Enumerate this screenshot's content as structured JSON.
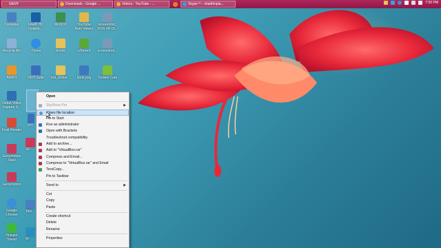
{
  "taskbar": {
    "tabs": [
      {
        "label": "GENY",
        "icon": "genymotion-icon",
        "color": "#c94747"
      },
      {
        "label": "Downloads - Google ...",
        "icon": "chrome-icon",
        "color": "#e8b23a"
      },
      {
        "label": "Videos - YouTube - ...",
        "icon": "chrome-icon",
        "color": "#e8b23a"
      },
      {
        "label": "Skype™ - shadhinpla...",
        "icon": "skype-icon",
        "color": "#29a8e0"
      }
    ],
    "time": "7:50 PM"
  },
  "desktop_icons": [
    {
      "label": "Computer",
      "color": "#4a7fc1"
    },
    {
      "label": "Intel® HD Graphic...",
      "color": "#1a5fa8"
    },
    {
      "label": "WinSCP",
      "color": "#3b8f4f"
    },
    {
      "label": "YouTube Auto Viewer",
      "color": "#e0b84a"
    },
    {
      "label": "screenshot_ 2016-08-15...",
      "color": "#7a9ab8"
    },
    {
      "label": "Recycle Bin",
      "color": "#8fb2d4"
    },
    {
      "label": "iTunes",
      "color": "#2f8fe3"
    },
    {
      "label": "books",
      "color": "#e6c25a"
    },
    {
      "label": "uTorrent",
      "color": "#5aa83a"
    },
    {
      "label": "screenshot...",
      "color": "#7a9ab8"
    },
    {
      "label": "AIMP3",
      "color": "#e8952a"
    },
    {
      "label": "NCH Suite",
      "color": "#3a6fbf"
    },
    {
      "label": "bot_clicker...",
      "color": "#e6c25a"
    },
    {
      "label": "book.png",
      "color": "#3c7abf"
    },
    {
      "label": "Toolwiz Care",
      "color": "#7dbf3a"
    },
    {
      "label": "Debut Video Capture S...",
      "color": "#2f6fb3"
    },
    {
      "label": "Foxit Reader",
      "color": "#d84a3a"
    },
    {
      "label": "Genymotion Shell",
      "color": "#c93a5a"
    },
    {
      "label": "Genymotion",
      "color": "#c93a5a"
    },
    {
      "label": "Google Chrome",
      "color": "#3a8fd8"
    },
    {
      "label": "Hotspot Shield",
      "color": "#3fb83f"
    }
  ],
  "partial_labels": {
    "behind1": "Sk",
    "behind2": "SH",
    "behind3": "SP",
    "behind4": "Tele",
    "behind5": "W"
  },
  "context_menu": {
    "items": [
      {
        "label": "Open",
        "bold": true
      },
      {
        "sep": true
      },
      {
        "label": "SkyDrive Pro",
        "disabled": true,
        "submenu": true,
        "icon": "#9ab0c8"
      },
      {
        "label": "Open file location",
        "highlighted": true,
        "icon": "#6a8fc7"
      },
      {
        "label": "Pin to Start"
      },
      {
        "label": "Run as administrator",
        "icon": "#3a6fbf"
      },
      {
        "label": "Open with Brackets",
        "icon": "#2f6f9f"
      },
      {
        "label": "Troubleshoot compatibility"
      },
      {
        "label": "Add to archive...",
        "icon": "#a83a5a"
      },
      {
        "label": "Add to \"VirtualBox.rar\"",
        "icon": "#a83a5a"
      },
      {
        "label": "Compress and Email...",
        "icon": "#a83a5a"
      },
      {
        "label": "Compress to \"VirtualBox.rar\" and Email",
        "icon": "#a83a5a"
      },
      {
        "label": "TeraCopy...",
        "icon": "#4a9a4a"
      },
      {
        "label": "Pin to Taskbar"
      },
      {
        "sep": true
      },
      {
        "label": "Send to",
        "submenu": true
      },
      {
        "sep": true
      },
      {
        "label": "Cut"
      },
      {
        "label": "Copy"
      },
      {
        "label": "Paste"
      },
      {
        "sep": true
      },
      {
        "label": "Create shortcut"
      },
      {
        "label": "Delete"
      },
      {
        "label": "Rename"
      },
      {
        "sep": true
      },
      {
        "label": "Properties"
      }
    ]
  }
}
